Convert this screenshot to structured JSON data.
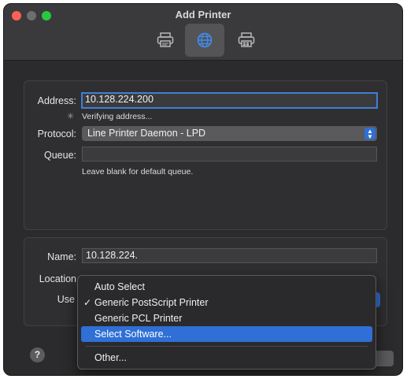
{
  "window": {
    "title": "Add Printer"
  },
  "toolbar": {
    "default_icon": "printer-icon",
    "ip_icon": "globe-icon",
    "windows_icon": "windows-printer-icon"
  },
  "form": {
    "address_label": "Address:",
    "address_value": "10.128.224.200",
    "verifying_text": "Verifying address...",
    "protocol_label": "Protocol:",
    "protocol_value": "Line Printer Daemon - LPD",
    "queue_label": "Queue:",
    "queue_value": "",
    "queue_hint": "Leave blank for default queue.",
    "name_label": "Name:",
    "name_value": "10.128.224.",
    "location_label": "Location",
    "use_label": "Use"
  },
  "menu": {
    "items": [
      {
        "label": "Auto Select",
        "checked": false
      },
      {
        "label": "Generic PostScript Printer",
        "checked": true
      },
      {
        "label": "Generic PCL Printer",
        "checked": false
      },
      {
        "label": "Select Software...",
        "checked": false,
        "highlighted": true
      }
    ],
    "check_glyph": "✓",
    "other_label": "Other..."
  },
  "help": {
    "label": "?"
  },
  "colors": {
    "accent": "#2f6fd6",
    "close": "#ff5f57",
    "maximize": "#28c840",
    "window_bg": "#2b2b2d"
  }
}
